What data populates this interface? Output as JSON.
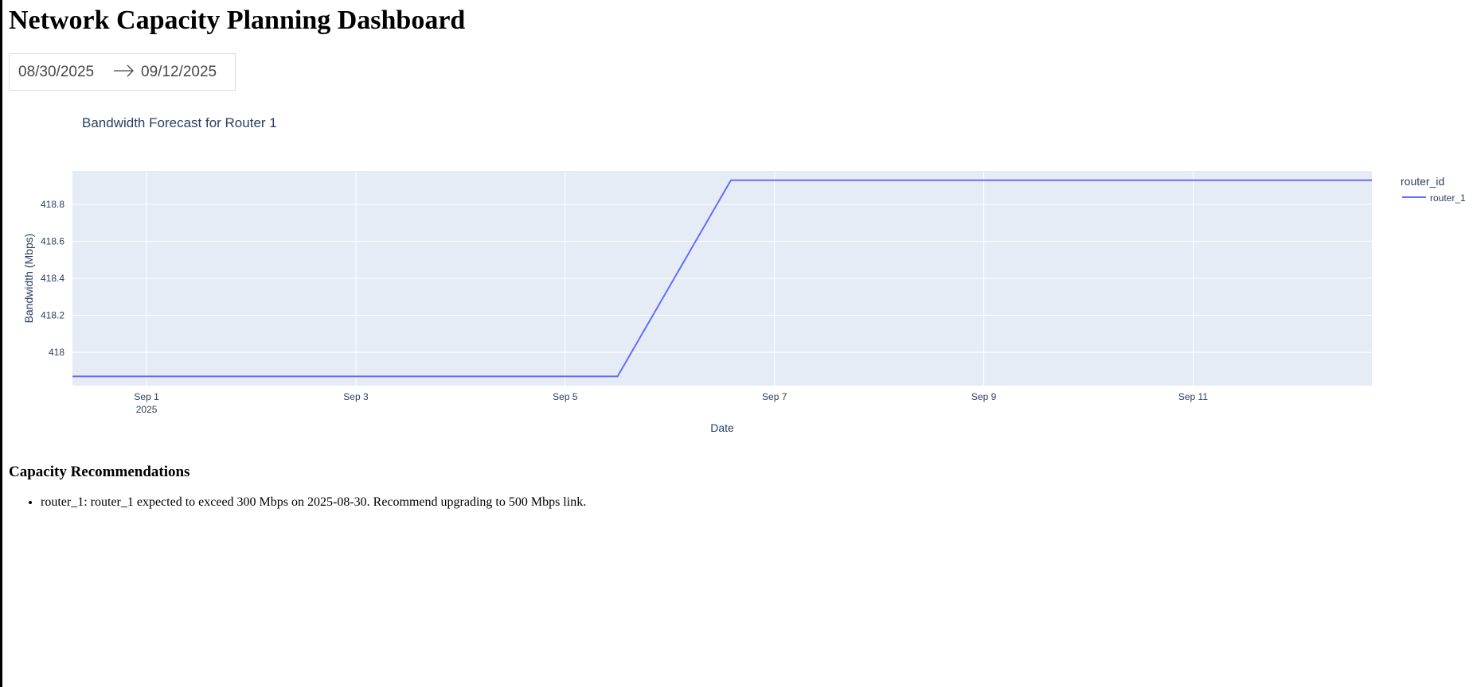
{
  "page": {
    "title": "Network Capacity Planning Dashboard"
  },
  "date_picker": {
    "start": "08/30/2025",
    "end": "09/12/2025",
    "arrow_icon": "arrow-right-icon"
  },
  "chart_data": {
    "type": "line",
    "title": "Bandwidth Forecast for Router 1",
    "xlabel": "Date",
    "ylabel": "Bandwidth (Mbps)",
    "x_range": [
      "2025-08-31T07:00",
      "2025-09-12T17:00"
    ],
    "y_range": [
      417.82,
      418.98
    ],
    "y_ticks": [
      418,
      418.2,
      418.4,
      418.6,
      418.8
    ],
    "y_tick_labels": [
      "418",
      "418.2",
      "418.4",
      "418.6",
      "418.8"
    ],
    "x_ticks": [
      "2025-09-01",
      "2025-09-03",
      "2025-09-05",
      "2025-09-07",
      "2025-09-09",
      "2025-09-11"
    ],
    "x_tick_labels": [
      "Sep 1",
      "Sep 3",
      "Sep 5",
      "Sep 7",
      "Sep 9",
      "Sep 11"
    ],
    "x_tick_sublabel": "2025",
    "grid": true,
    "legend": {
      "title": "router_id",
      "position": "right"
    },
    "series": [
      {
        "name": "router_1",
        "color": "#636efa",
        "points": [
          {
            "x": "2025-08-31T07:00",
            "y": 417.87
          },
          {
            "x": "2025-09-05T12:00",
            "y": 417.87
          },
          {
            "x": "2025-09-06T14:00",
            "y": 418.93
          },
          {
            "x": "2025-09-12T17:00",
            "y": 418.93
          }
        ]
      }
    ],
    "colors": {
      "plot_bg": "#e5ecf6",
      "grid": "#ffffff",
      "text": "#2a3f5f"
    }
  },
  "recommendations": {
    "heading": "Capacity Recommendations",
    "items": [
      "router_1: router_1 expected to exceed 300 Mbps on 2025-08-30. Recommend upgrading to 500 Mbps link."
    ]
  }
}
